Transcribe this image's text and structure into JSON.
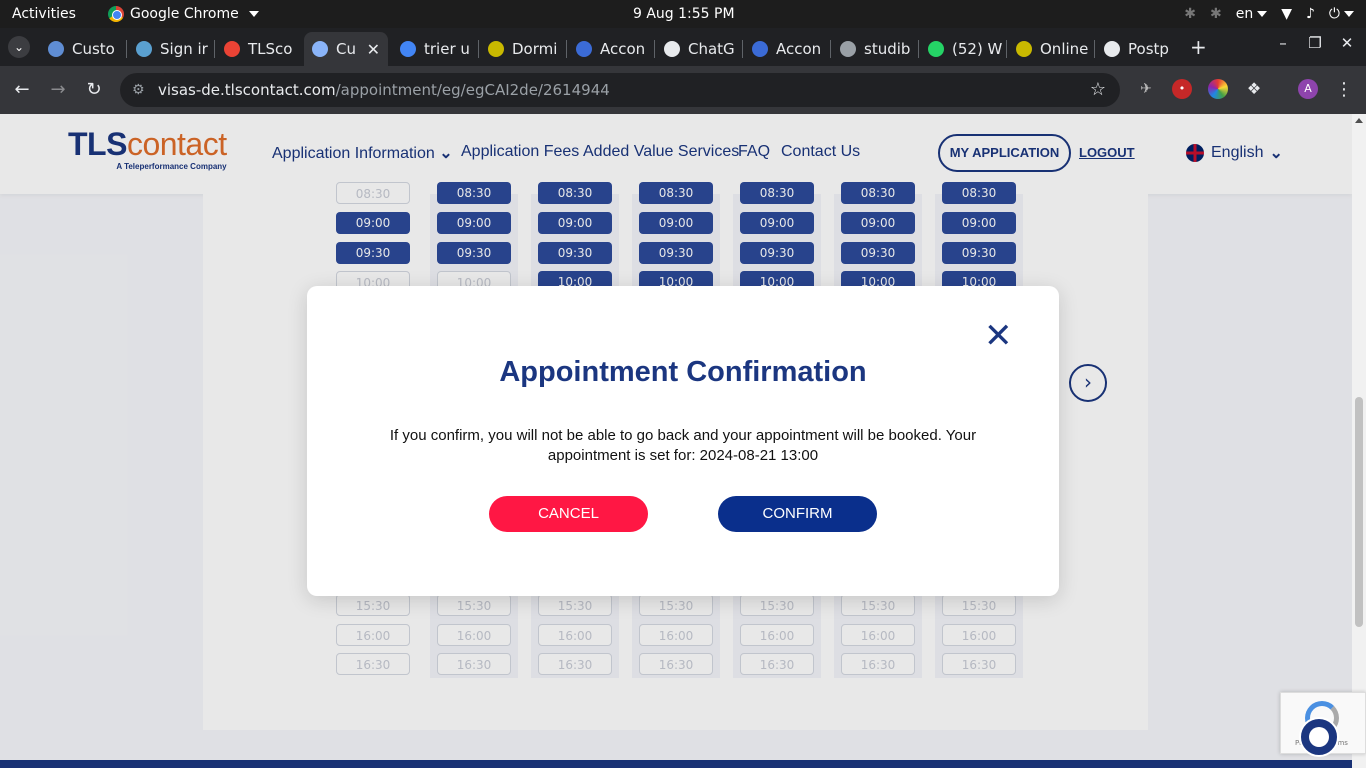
{
  "topbar": {
    "activities": "Activities",
    "app_name": "Google Chrome",
    "clock": "9 Aug  1:55 PM",
    "lang": "en"
  },
  "tabs": [
    {
      "label": "Custo",
      "fav": "#5f8dd3"
    },
    {
      "label": "Sign ir",
      "fav": "#5aa0d0"
    },
    {
      "label": "TLSco",
      "fav": "#ea4335"
    },
    {
      "label": "Cu",
      "fav": "#8ab4f8",
      "active": true
    },
    {
      "label": "trier u",
      "fav": "#4285f4"
    },
    {
      "label": "Dormi",
      "fav": "#c9b900"
    },
    {
      "label": "Accon",
      "fav": "#3b6bd6"
    },
    {
      "label": "ChatG",
      "fav": "#e8eaed"
    },
    {
      "label": "Accon",
      "fav": "#3b6bd6"
    },
    {
      "label": "studib",
      "fav": "#9aa0a6"
    },
    {
      "label": "(52) W",
      "fav": "#25d366"
    },
    {
      "label": "Online",
      "fav": "#c9b900"
    },
    {
      "label": "Postp",
      "fav": "#e8eaed"
    }
  ],
  "toolbar": {
    "url_host": "visas-de.tlscontact.com",
    "url_path": "/appointment/eg/egCAI2de/2614944",
    "profile_initial": "A"
  },
  "header": {
    "logo_tls": "TLS",
    "logo_contact": "contact",
    "logo_tagline": "A Teleperformance Company",
    "nav": [
      "Application Information",
      "Application Fees",
      "Added Value Services",
      "FAQ",
      "Contact Us"
    ],
    "my_application": "MY APPLICATION",
    "logout": "LOGOUT",
    "language": "English"
  },
  "calendar": {
    "times_top": [
      "08:30",
      "09:00",
      "09:30",
      "10:00"
    ],
    "times_bottom": [
      "15:30",
      "16:00",
      "16:30"
    ],
    "top_availability": [
      [
        false,
        true,
        true,
        false
      ],
      [
        true,
        true,
        true,
        false
      ],
      [
        true,
        true,
        true,
        true
      ],
      [
        true,
        true,
        true,
        true
      ],
      [
        true,
        true,
        true,
        true
      ],
      [
        true,
        true,
        true,
        true
      ],
      [
        true,
        true,
        true,
        true
      ]
    ]
  },
  "modal": {
    "title": "Appointment Confirmation",
    "message": "If you confirm, you will not be able to go back and your appointment will be booked. Your appointment is set for: 2024-08-21 13:00",
    "cancel": "CANCEL",
    "confirm": "CONFIRM"
  },
  "recaptcha": {
    "text": "Privacy - Terms"
  }
}
